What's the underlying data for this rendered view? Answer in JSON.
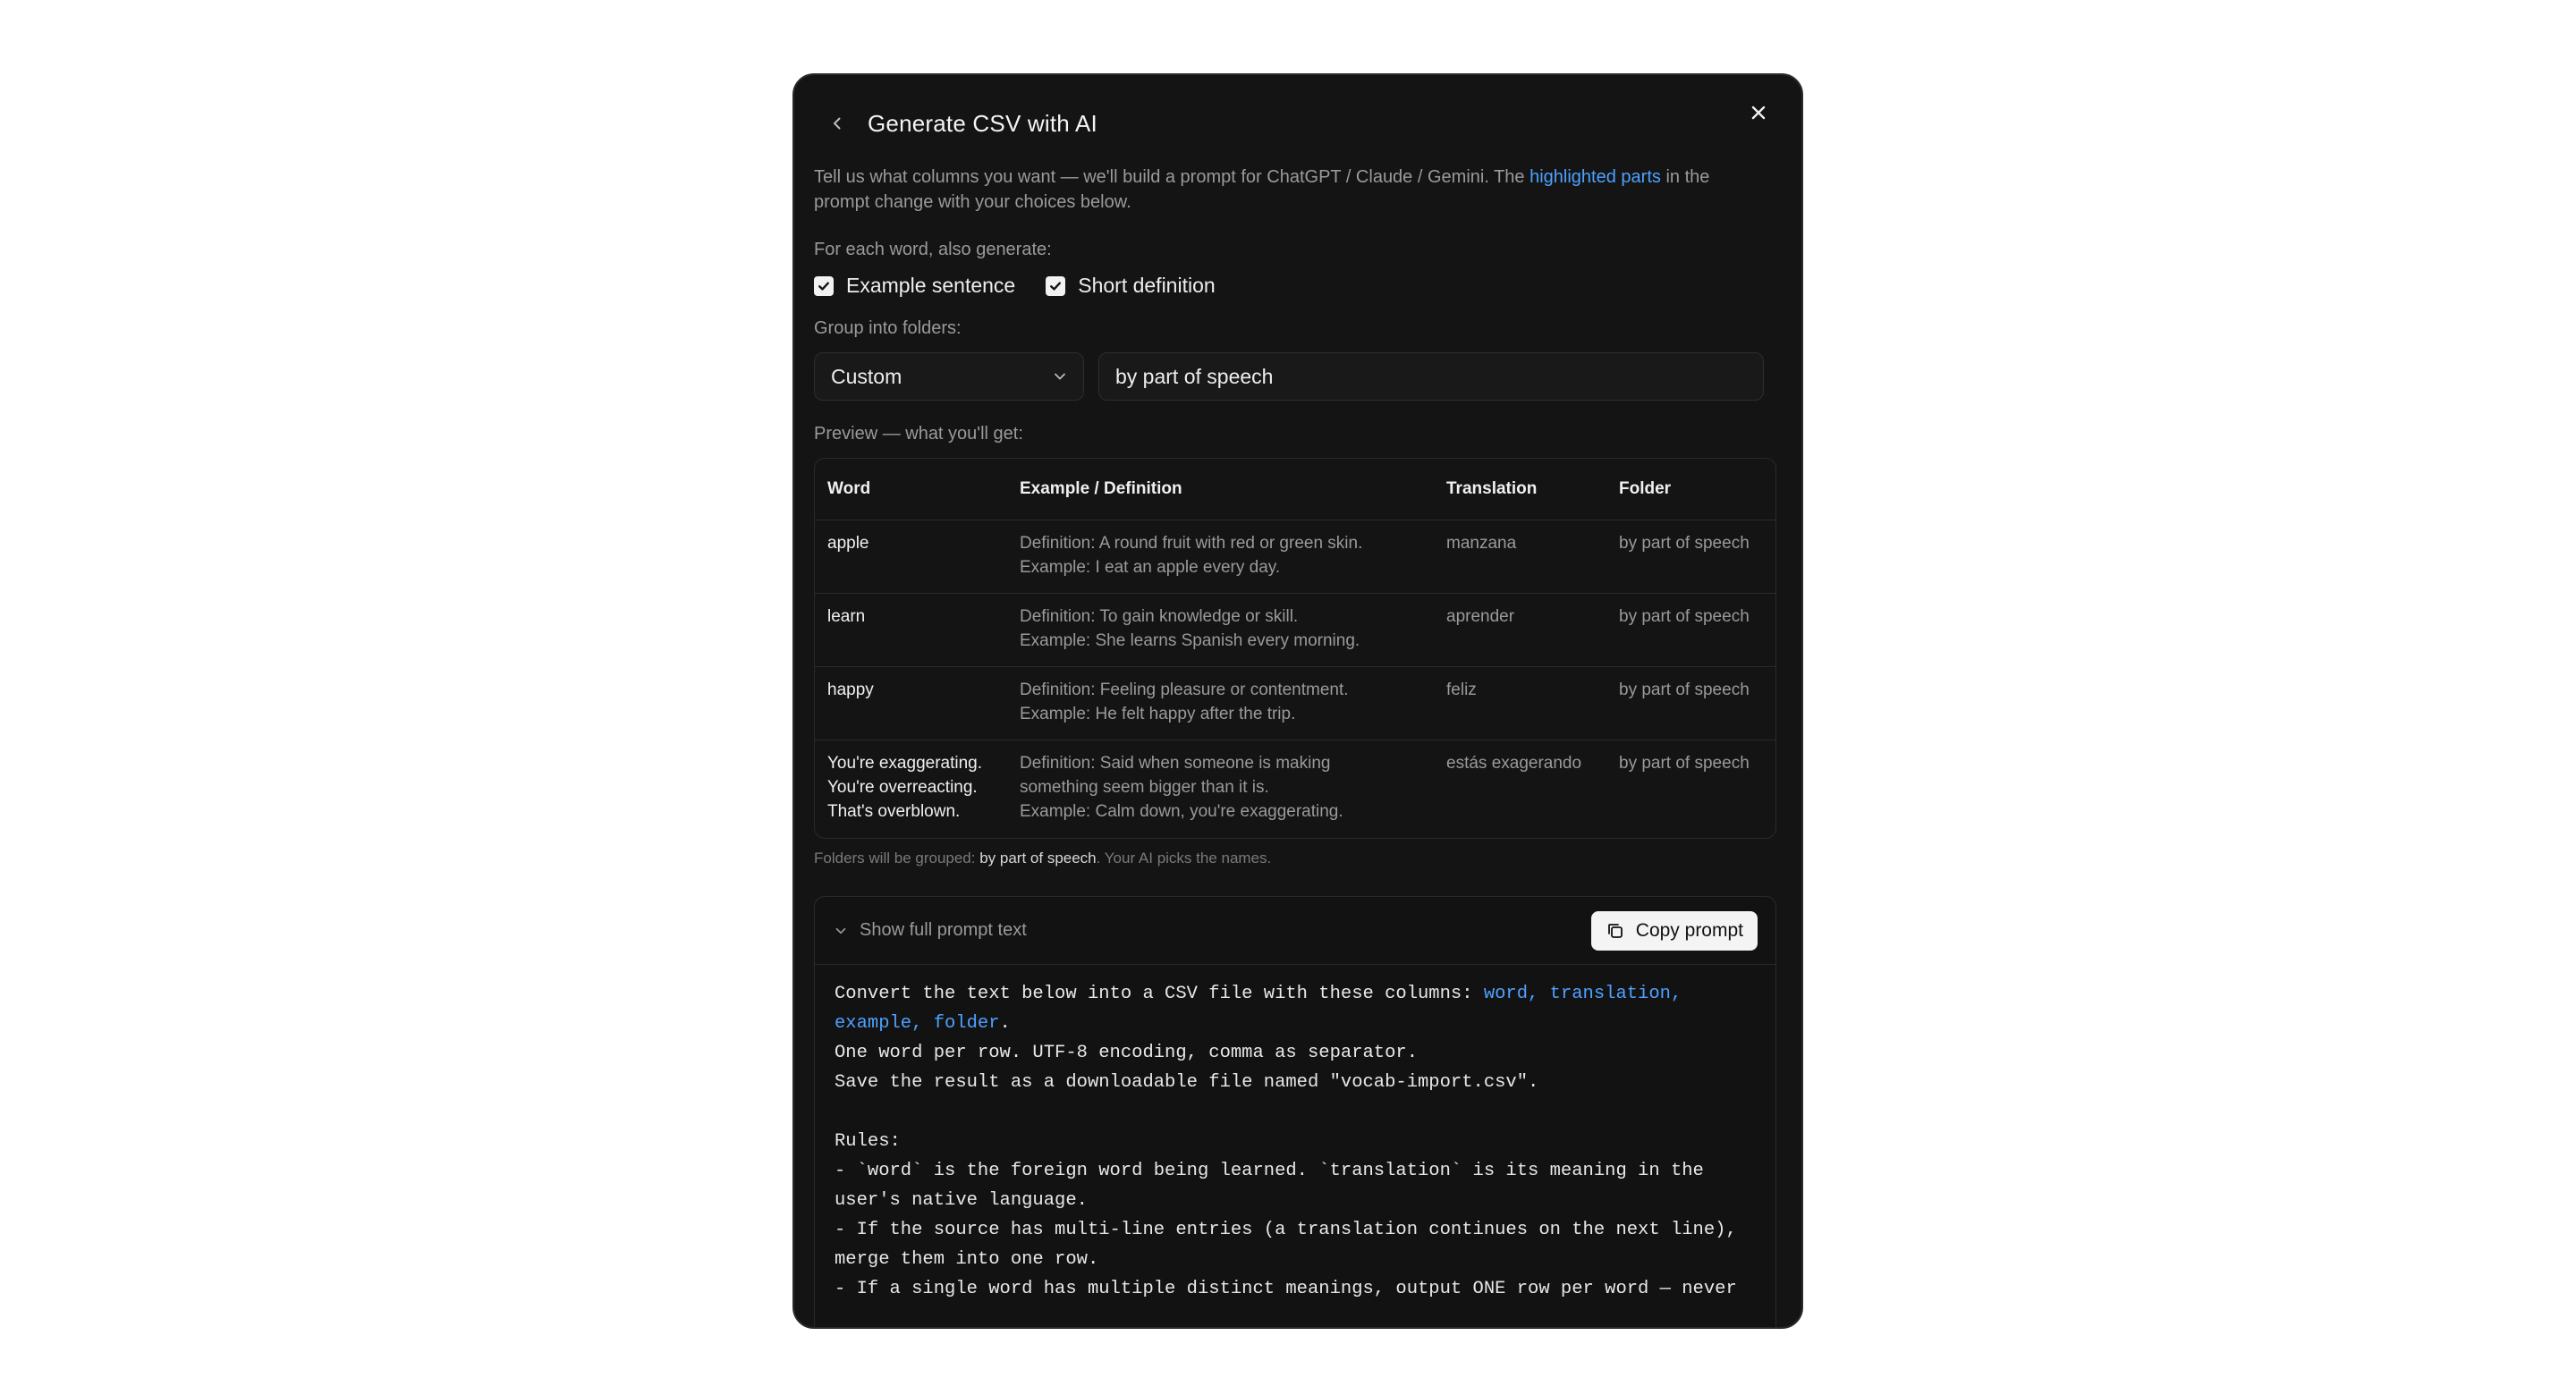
{
  "dialog": {
    "title": "Generate CSV with AI",
    "intro_before": "Tell us what columns you want — we'll build a prompt for ChatGPT / Claude / Gemini. The ",
    "intro_highlight": "highlighted parts",
    "intro_after": " in the prompt change with your choices below."
  },
  "generate": {
    "label": "For each word, also generate:",
    "options": [
      {
        "label": "Example sentence",
        "checked": true
      },
      {
        "label": "Short definition",
        "checked": true
      }
    ]
  },
  "grouping": {
    "label": "Group into folders:",
    "select_value": "Custom",
    "custom_value": "by part of speech"
  },
  "preview": {
    "label": "Preview — what you'll get:",
    "columns": [
      "Word",
      "Example / Definition",
      "Translation",
      "Folder"
    ],
    "rows": [
      {
        "word": [
          "apple"
        ],
        "example": [
          "Definition: A round fruit with red or green skin.",
          "Example: I eat an apple every day."
        ],
        "translation": "manzana",
        "folder": "by part of speech"
      },
      {
        "word": [
          "learn"
        ],
        "example": [
          "Definition: To gain knowledge or skill.",
          "Example: She learns Spanish every morning."
        ],
        "translation": "aprender",
        "folder": "by part of speech"
      },
      {
        "word": [
          "happy"
        ],
        "example": [
          "Definition: Feeling pleasure or contentment.",
          "Example: He felt happy after the trip."
        ],
        "translation": "feliz",
        "folder": "by part of speech"
      },
      {
        "word": [
          "You're exaggerating.",
          "You're overreacting.",
          "That's overblown."
        ],
        "example": [
          "Definition: Said when someone is making",
          "something seem bigger than it is.",
          "Example: Calm down, you're exaggerating."
        ],
        "translation": "estás exagerando",
        "folder": "by part of speech"
      }
    ],
    "note_before": "Folders will be grouped: ",
    "note_value": "by part of speech",
    "note_after": ". Your AI picks the names."
  },
  "prompt": {
    "toggle_label": "Show full prompt text",
    "copy_label": "Copy prompt",
    "lines": [
      [
        {
          "t": "Convert the text below into a CSV file with these columns: "
        },
        {
          "t": "word, translation,",
          "hl": true
        }
      ],
      [
        {
          "t": "example, folder",
          "hl": true
        },
        {
          "t": "."
        }
      ],
      [
        {
          "t": "One word per row. UTF-8 encoding, comma as separator."
        }
      ],
      [
        {
          "t": "Save the result as a downloadable file named \"vocab-import.csv\"."
        }
      ],
      [
        {
          "t": ""
        }
      ],
      [
        {
          "t": "Rules:"
        }
      ],
      [
        {
          "t": "- `word` is the foreign word being learned. `translation` is its meaning in the"
        }
      ],
      [
        {
          "t": "user's native language."
        }
      ],
      [
        {
          "t": "- If the source has multi-line entries (a translation continues on the next line),"
        }
      ],
      [
        {
          "t": "merge them into one row."
        }
      ],
      [
        {
          "t": "- If a single word has multiple distinct meanings, output ONE row per word — never"
        }
      ]
    ]
  },
  "colors": {
    "accent": "#4ea1ff",
    "panel": "#141414",
    "border": "#2a2a2a"
  }
}
